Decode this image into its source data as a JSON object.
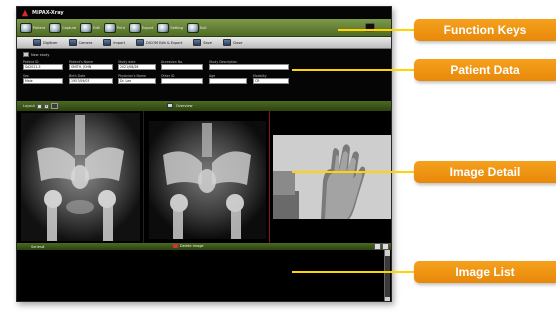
{
  "app": {
    "title": "MiPAX-Xray"
  },
  "function_keys": [
    {
      "label": "Patient",
      "icon": "patient-icon"
    },
    {
      "label": "Capture",
      "icon": "camera-icon"
    },
    {
      "label": "Edit",
      "icon": "edit-icon"
    },
    {
      "label": "Print",
      "icon": "printer-icon"
    },
    {
      "label": "Export",
      "icon": "export-icon"
    },
    {
      "label": "Setting",
      "icon": "gear-icon"
    },
    {
      "label": "Exit",
      "icon": "exit-icon"
    }
  ],
  "toolbar": [
    {
      "label": "Digitizer",
      "icon": "digitizer-icon"
    },
    {
      "label": "Camera",
      "icon": "camera-icon"
    },
    {
      "label": "Import",
      "icon": "import-icon"
    },
    {
      "label": "DICOM Edit & Export",
      "icon": "dicom-icon"
    },
    {
      "label": "Save",
      "icon": "save-icon"
    },
    {
      "label": "Close",
      "icon": "close-icon"
    }
  ],
  "patient": {
    "new_study_label": "New study",
    "patient_id": {
      "label": "Patient ID",
      "value": "SA2021-5"
    },
    "patient_name": {
      "label": "Patient's Name",
      "value": "SMITH, JOHN"
    },
    "study_date": {
      "label": "Study date",
      "value": "2021/08/26"
    },
    "accession": {
      "label": "Accession No.",
      "value": ""
    },
    "study_description": {
      "label": "Study Description",
      "value": ""
    },
    "sex": {
      "label": "Sex",
      "value": "Male"
    },
    "birth_date": {
      "label": "Birth Date",
      "value": "1957/09/03"
    },
    "physician": {
      "label": "Physician's Name",
      "value": "Dr. Lee"
    },
    "other_id": {
      "label": "Other ID",
      "value": ""
    },
    "age": {
      "label": "Age",
      "value": ""
    },
    "modality": {
      "label": "Modality",
      "value": "CR"
    }
  },
  "viewer": {
    "layout_label": "Layout",
    "page_value": "1",
    "tools_label": "Overview"
  },
  "image_list": {
    "left_label": "Series#",
    "middle_label": "Delete Image"
  },
  "callouts": [
    {
      "label": "Function Keys"
    },
    {
      "label": "Patient Data"
    },
    {
      "label": "Image Detail"
    },
    {
      "label": "Image List"
    }
  ],
  "colors": {
    "callout": "#f39c1a",
    "callout_line": "#ffd400",
    "function_bar": "#5a7a2a",
    "window_bg": "#000000"
  }
}
